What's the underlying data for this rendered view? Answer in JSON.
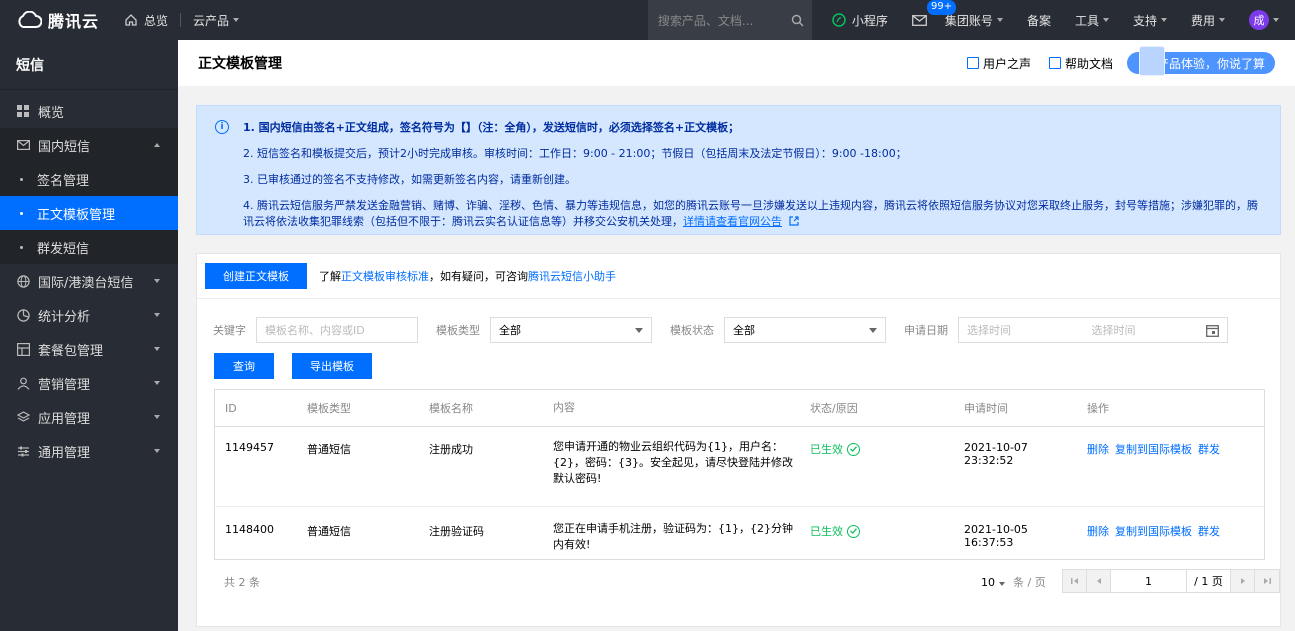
{
  "topbar": {
    "logo": "腾讯云",
    "overview": "总览",
    "products": "云产品",
    "search_placeholder": "搜索产品、文档...",
    "mini_program": "小程序",
    "mail_badge": "99+",
    "account": "集团账号",
    "filing": "备案",
    "tools": "工具",
    "support": "支持",
    "billing": "费用",
    "avatar": "成"
  },
  "sidebar": {
    "title": "短信",
    "overview": "概览",
    "domestic": "国内短信",
    "sub_sign": "签名管理",
    "sub_template": "正文模板管理",
    "sub_group": "群发短信",
    "intl": "国际/港澳台短信",
    "stats": "统计分析",
    "package": "套餐包管理",
    "marketing": "营销管理",
    "app": "应用管理",
    "general": "通用管理"
  },
  "header": {
    "title": "正文模板管理",
    "user_voice": "用户之声",
    "help_doc": "帮助文档",
    "feedback": "产品体验，你说了算"
  },
  "notice": {
    "line1": "1. 国内短信由签名+正文组成，签名符号为【】（注：全角），发送短信时，必须选择签名+正文模板；",
    "line2": "2. 短信签名和模板提交后，预计2小时完成审核。审核时间：工作日：9:00 - 21:00；节假日（包括周末及法定节假日）：9:00 -18:00；",
    "line3": "3. 已审核通过的签名不支持修改，如需更新签名内容，请重新创建。",
    "line4a": "4. 腾讯云短信服务严禁发送金融营销、赌博、诈骗、淫秽、色情、暴力等违规信息，如您的腾讯云账号一旦涉嫌发送以上违规内容，腾讯云将依照短信服务协议对您采取终止服务，封号等措施；涉嫌犯罪的，腾",
    "line4b": "讯云将依法收集犯罪线索（包括但不限于：腾讯云实名认证信息等）并移交公安机关处理，",
    "line4_link": "详情请查看官网公告"
  },
  "panel": {
    "create_btn": "创建正文模板",
    "hint_pre": "了解",
    "hint_link1": "正文模板审核标准",
    "hint_mid": "，如有疑问，可咨询",
    "hint_link2": "腾讯云短信小助手"
  },
  "filters": {
    "keyword_label": "关键字",
    "keyword_placeholder": "模板名称、内容或ID",
    "type_label": "模板类型",
    "type_value": "全部",
    "status_label": "模板状态",
    "status_value": "全部",
    "date_label": "申请日期",
    "date_start": "选择时间",
    "date_end": "选择时间",
    "query_btn": "查询",
    "export_btn": "导出模板"
  },
  "table": {
    "headers": [
      "ID",
      "模板类型",
      "模板名称",
      "内容",
      "状态/原因",
      "申请时间",
      "操作"
    ],
    "rows": [
      {
        "id": "1149457",
        "type": "普通短信",
        "name": "注册成功",
        "content": "您申请开通的物业云组织代码为{1}，用户名：{2}，密码：{3}。安全起见，请尽快登陆并修改默认密码!",
        "status": "已生效",
        "time": "2021-10-07 23:32:52",
        "op_delete": "删除",
        "op_copy": "复制到国际模板",
        "op_send": "群发"
      },
      {
        "id": "1148400",
        "type": "普通短信",
        "name": "注册验证码",
        "content": "您正在申请手机注册，验证码为：{1}，{2}分钟内有效!",
        "status": "已生效",
        "time": "2021-10-05 16:37:53",
        "op_delete": "删除",
        "op_copy": "复制到国际模板",
        "op_send": "群发"
      }
    ]
  },
  "pager": {
    "total": "共 2 条",
    "page_size": "10",
    "page_size_unit": "条 / 页",
    "current": "1",
    "of_pages": "/ 1 页"
  }
}
